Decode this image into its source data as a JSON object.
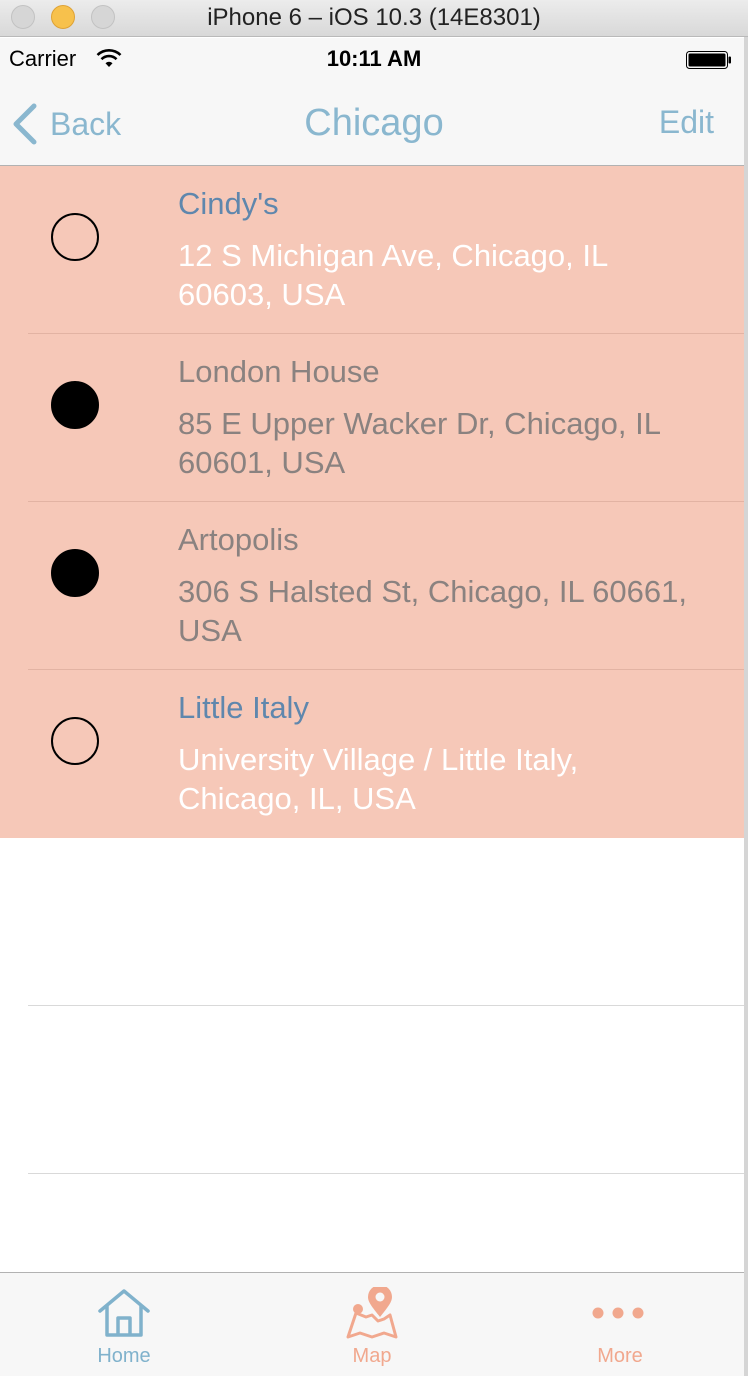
{
  "window": {
    "title": "iPhone 6 – iOS 10.3 (14E8301)"
  },
  "status_bar": {
    "carrier": "Carrier",
    "time": "10:11 AM"
  },
  "nav": {
    "back_label": "Back",
    "title": "Chicago",
    "edit_label": "Edit"
  },
  "colors": {
    "accent": "#8ab7cf",
    "row_background": "#f6c8b8",
    "unchecked_title": "#5f87ad",
    "checked_text": "#8a8280",
    "tab_inactive": "#f1a88e"
  },
  "places": [
    {
      "name": "Cindy's",
      "address": "12 S Michigan Ave, Chicago, IL 60603, USA",
      "checked": false
    },
    {
      "name": "London House",
      "address": "85 E Upper Wacker Dr, Chicago, IL 60601, USA",
      "checked": true
    },
    {
      "name": "Artopolis",
      "address": "306 S Halsted St, Chicago, IL 60661, USA",
      "checked": true
    },
    {
      "name": "Little Italy",
      "address": "University Village / Little Italy, Chicago, IL, USA",
      "checked": false
    }
  ],
  "tabs": [
    {
      "label": "Home",
      "icon": "home-icon",
      "selected": true
    },
    {
      "label": "Map",
      "icon": "map-pin-icon",
      "selected": false
    },
    {
      "label": "More",
      "icon": "more-dots-icon",
      "selected": false
    }
  ]
}
